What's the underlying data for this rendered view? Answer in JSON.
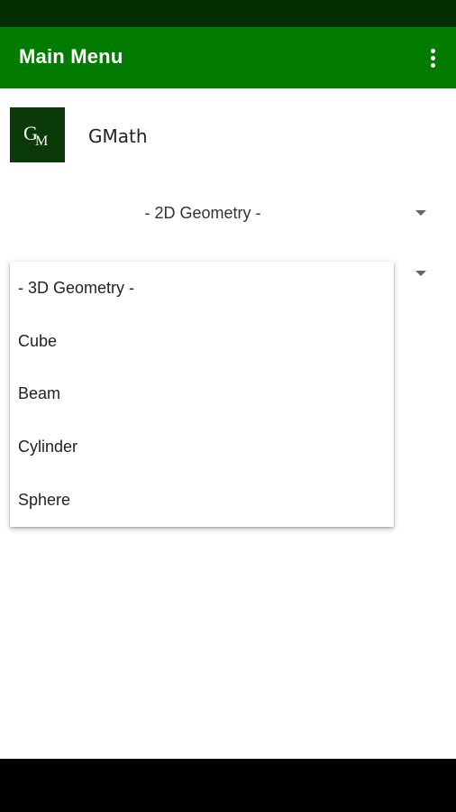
{
  "app_bar": {
    "title": "Main Menu",
    "overflow_icon": "more-vert-icon"
  },
  "colors": {
    "status_bar": "#032e02",
    "app_bar": "#027b01",
    "logo_bg": "#0a3a08"
  },
  "header": {
    "logo_text": "GM",
    "app_name": "GMath"
  },
  "spinner_2d": {
    "selected": "- 2D Geometry -",
    "icon": "dropdown-arrow-icon"
  },
  "spinner_3d": {
    "icon": "dropdown-arrow-icon",
    "options": [
      "- 3D Geometry -",
      "Cube",
      "Beam",
      "Cylinder",
      "Sphere"
    ]
  }
}
